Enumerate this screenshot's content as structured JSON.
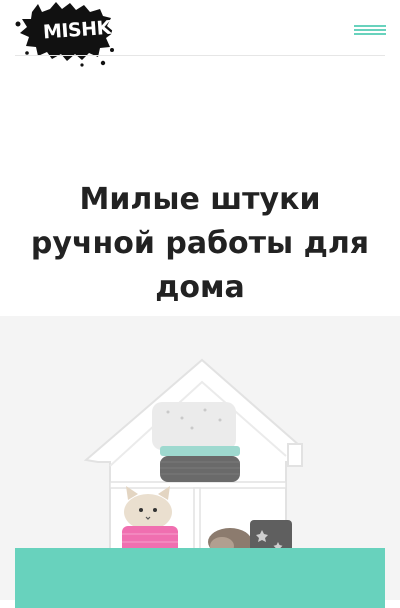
{
  "header": {
    "logo_text": "MISHKA",
    "logo_icon": "mishka-logo",
    "menu_icon": "hamburger-menu-icon"
  },
  "hero": {
    "title": "Милые штуки ручной работы для дома",
    "image": "knitted-toys-on-house-shelf"
  },
  "colors": {
    "accent": "#68d2bd",
    "text": "#222222",
    "logo_background": "#111111"
  }
}
